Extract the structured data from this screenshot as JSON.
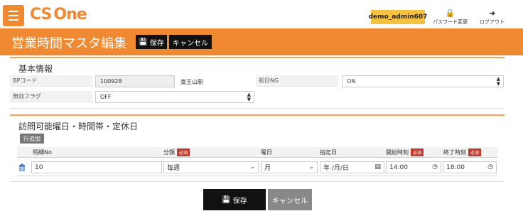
{
  "header": {
    "logo_cs": "CS",
    "logo_one": "One",
    "user": "demo_admin607",
    "password_change": "パスワード変更",
    "logout": "ログアウト"
  },
  "title_bar": {
    "title": "営業時間マスタ編集",
    "save": "保存",
    "cancel": "キャンセル"
  },
  "basic_info": {
    "section_title": "基本情報",
    "bp_code_label": "BPコード",
    "bp_code_value": "100928",
    "bp_name": "寛王山駅",
    "holiday_ng_label": "祝日NG",
    "holiday_ng_value": "ON",
    "invalid_flag_label": "無効フラグ",
    "invalid_flag_value": "OFF"
  },
  "schedule": {
    "section_title": "訪問可能曜日・時間帯・定休日",
    "add_row": "行追加",
    "required_badge": "必須",
    "columns": {
      "detail_no": "明細No",
      "category": "分類",
      "weekday": "曜日",
      "date": "指定日",
      "start_time": "開始時刻",
      "end_time": "終了時刻"
    },
    "rows": [
      {
        "detail_no": "10",
        "category": "毎週",
        "weekday": "月",
        "date": "年 /月/日",
        "start_time": "14:00",
        "end_time": "18:00"
      }
    ]
  },
  "footer": {
    "save": "保存",
    "cancel": "キャンセル"
  },
  "colors": {
    "accent": "#ef8a32",
    "badge": "#f5c242",
    "required": "#c0392b",
    "trash": "#3a73c2"
  }
}
